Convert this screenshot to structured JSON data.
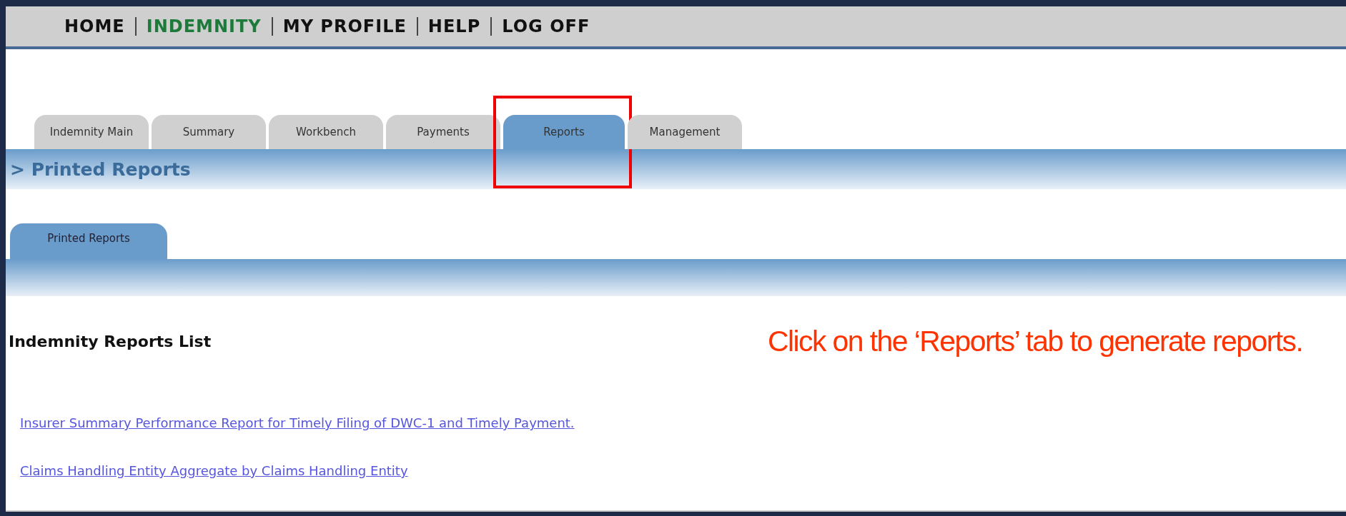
{
  "nav": [
    {
      "label": "HOME",
      "selected": false
    },
    {
      "label": "INDEMNITY",
      "selected": true
    },
    {
      "label": "MY PROFILE",
      "selected": false
    },
    {
      "label": "HELP",
      "selected": false
    },
    {
      "label": "LOG OFF",
      "selected": false
    }
  ],
  "tabs": [
    {
      "label": "Indemnity Main",
      "selected": false,
      "highlighted": false
    },
    {
      "label": "Summary",
      "selected": false,
      "highlighted": false
    },
    {
      "label": "Workbench",
      "selected": false,
      "highlighted": false
    },
    {
      "label": "Payments",
      "selected": false,
      "highlighted": false
    },
    {
      "label": "Reports",
      "selected": true,
      "highlighted": true
    },
    {
      "label": "Management",
      "selected": false,
      "highlighted": false
    }
  ],
  "breadcrumb": "> Printed Reports",
  "subtabs": [
    {
      "label": "Printed Reports",
      "selected": true
    }
  ],
  "heading": "Indemnity Reports List",
  "callout": "Click on the ‘Reports’ tab to generate reports.",
  "links": [
    "Insurer Summary Performance Report for Timely Filing of DWC-1 and Timely Payment.",
    "Claims Handling Entity Aggregate by Claims Handling Entity"
  ]
}
